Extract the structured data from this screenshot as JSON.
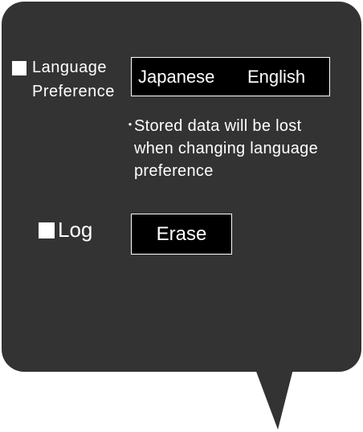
{
  "colors": {
    "panel_bg": "#333333",
    "box_bg": "#000000",
    "text": "#ffffff"
  },
  "language": {
    "label_line1": "Language",
    "label_line2": "Preference",
    "options": [
      "Japanese",
      "English"
    ]
  },
  "note": {
    "bullet": "・",
    "line1": "Stored data will be lost",
    "line2": "when changing language",
    "line3": "preference"
  },
  "log": {
    "label": "Log",
    "erase_label": "Erase"
  }
}
